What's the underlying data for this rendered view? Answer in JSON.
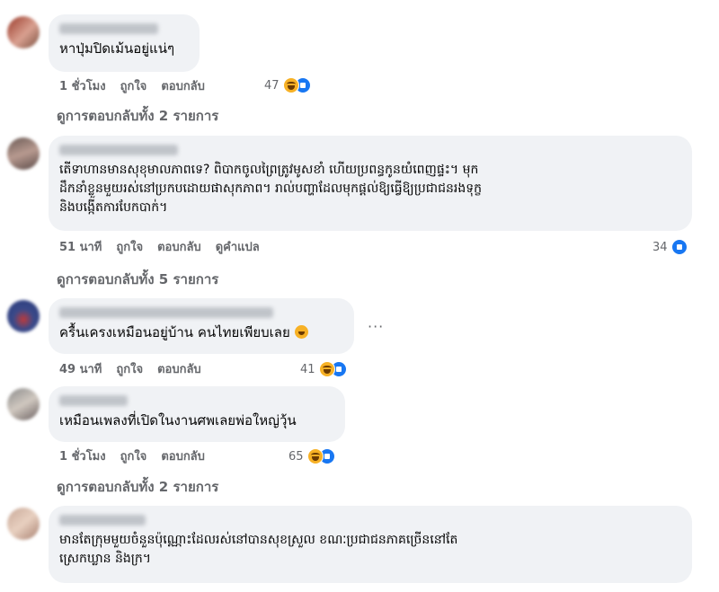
{
  "comments": [
    {
      "text": "หาปุ่มปิดเม้นอยู่แน่ๆ",
      "time": "1 ชั่วโมง",
      "like": "ถูกใจ",
      "reply": "ตอบกลับ",
      "reaction_count": "47",
      "reactions": [
        "haha-icon",
        "like-icon"
      ],
      "view_replies": "ดูการตอบกลับทั้ง 2 รายการ"
    },
    {
      "text": "តើទាហានមានសុខុមាលភាពទេ? ពិបាកចូលព្រៃត្រូវមូសខាំ ហើយប្រពន្ធកូនយំពេញផ្ទះ។ មុក\nដឹកនាំខ្លួនមួយរស់នៅប្រកបដោយផាសុកភាព។ រាល់បញ្ហាដែលមុកផ្តល់ឱ្យធ្វើឱ្យប្រជាជនរងទុក្ខ\nនិងបង្កើតការបែកបាក់។",
      "time": "51 นาที",
      "like": "ถูกใจ",
      "reply": "ตอบกลับ",
      "translate": "ดูคำแปล",
      "reaction_count": "34",
      "reactions": [
        "like-icon"
      ],
      "view_replies": "ดูการตอบกลับทั้ง 5 รายการ"
    },
    {
      "text": "ครื้นเครงเหมือนอยู่บ้าน คนไทยเพียบเลย",
      "time": "49 นาที",
      "like": "ถูกใจ",
      "reply": "ตอบกลับ",
      "reaction_count": "41",
      "reactions": [
        "haha-icon",
        "like-icon"
      ],
      "more": "···"
    },
    {
      "text": "เหมือนเพลงที่เปิดในงานศพเลยพ่อใหญ่วุ้น",
      "time": "1 ชั่วโมง",
      "like": "ถูกใจ",
      "reply": "ตอบกลับ",
      "reaction_count": "65",
      "reactions": [
        "haha-icon",
        "like-icon"
      ],
      "view_replies": "ดูการตอบกลับทั้ง 2 รายการ"
    },
    {
      "text": "មានតែក្រុមមួយចំនួនប៉ុណ្ណោះដែលរស់នៅបានសុខស្រួល ខណៈប្រជាជនភាគច្រើននៅតែ\nស្រេកឃ្លាន និងក្រ។"
    }
  ],
  "colors": {
    "bubble": "#f0f2f5",
    "meta": "#65676b",
    "like_blue": "#1877f2",
    "haha_yellow": "#f7b125"
  }
}
